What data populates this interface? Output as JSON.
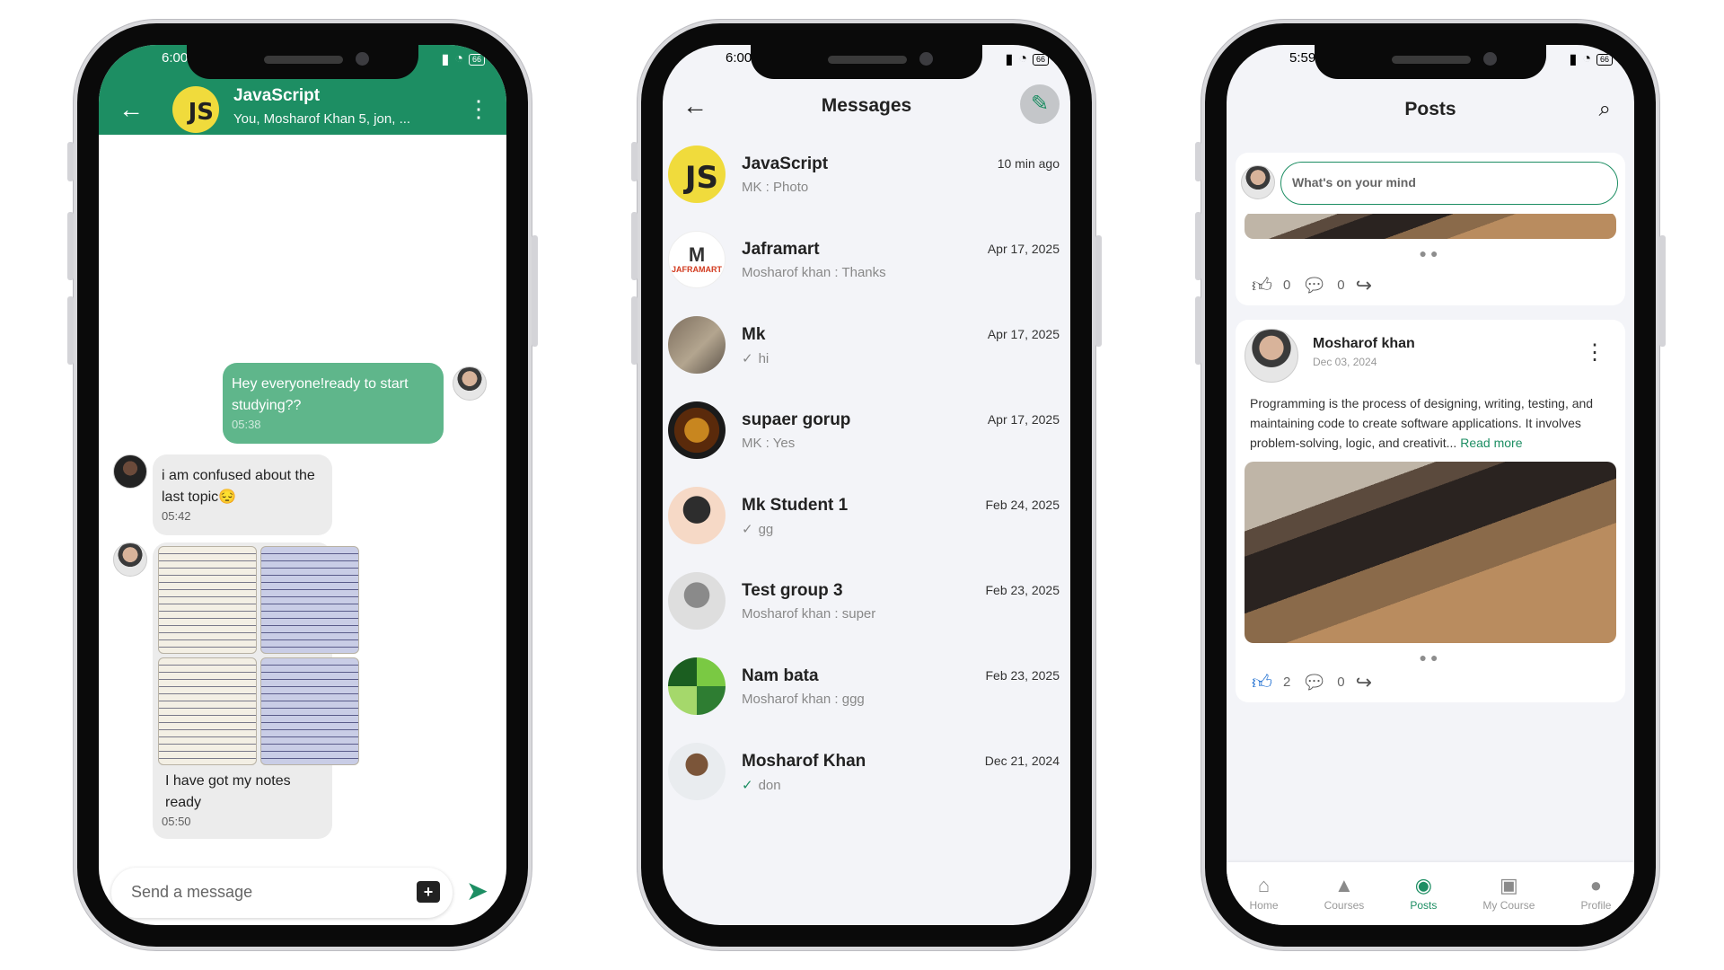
{
  "colors": {
    "primary_green": "#1d8e63",
    "bubble_out": "#5fb68b",
    "js_yellow": "#f0db3c",
    "like_blue": "#1f6fd1"
  },
  "chat_screen": {
    "status_time": "6:00",
    "battery": "66",
    "header": {
      "title": "JavaScript",
      "subtitle": "You, Mosharof Khan 5, jon, ...",
      "avatar_text": "JS"
    },
    "messages": [
      {
        "direction": "out",
        "text": "Hey everyone!ready to start studying??",
        "time": "05:38"
      },
      {
        "direction": "in",
        "text": "i am confused about the last topic😔",
        "time": "05:42"
      },
      {
        "direction": "in",
        "type": "image",
        "caption": "I have got my notes ready",
        "time": "05:50"
      }
    ],
    "composer": {
      "placeholder": "Send a message"
    }
  },
  "messages_screen": {
    "status_time": "6:00",
    "battery": "66",
    "title": "Messages",
    "conversations": [
      {
        "name": "JavaScript",
        "avatar_text": "JS",
        "last": "MK :  Photo",
        "date": "10 min ago"
      },
      {
        "name": "Jaframart",
        "avatar_text": "JAFRAMART",
        "last": "Mosharof khan :  Thanks",
        "date": "Apr 17, 2025"
      },
      {
        "name": "Mk",
        "last": "hi",
        "date": "Apr 17, 2025",
        "tick": "single"
      },
      {
        "name": "supaer gorup",
        "last": "MK :  Yes",
        "date": "Apr 17, 2025"
      },
      {
        "name": "Mk Student 1",
        "last": "gg",
        "date": "Feb 24, 2025",
        "tick": "single"
      },
      {
        "name": "Test group 3",
        "last": "Mosharof khan :  super",
        "date": "Feb 23, 2025"
      },
      {
        "name": "Nam bata",
        "last": "Mosharof khan :  ggg",
        "date": "Feb 23, 2025"
      },
      {
        "name": "Mosharof Khan",
        "last": "don",
        "date": "Dec 21, 2024",
        "tick": "double"
      }
    ]
  },
  "posts_screen": {
    "status_time": "5:59",
    "battery": "66",
    "title": "Posts",
    "compose_placeholder": "What's on your mind",
    "posts": [
      {
        "likes": "0",
        "comments": "0",
        "liked": false
      },
      {
        "author": "Mosharof khan",
        "date": "Dec 03, 2024",
        "text": "Programming is the process of designing, writing, testing, and maintaining code to create software applications. It involves problem-solving, logic, and creativit...",
        "read_more": "Read more",
        "likes": "2",
        "comments": "0",
        "liked": true
      }
    ],
    "nav": [
      {
        "label": "Home",
        "icon": "home-icon",
        "active": false
      },
      {
        "label": "Courses",
        "icon": "courses-icon",
        "active": false
      },
      {
        "label": "Posts",
        "icon": "posts-icon",
        "active": true
      },
      {
        "label": "My Course",
        "icon": "bag-icon",
        "active": false
      },
      {
        "label": "Profile",
        "icon": "person-icon",
        "active": false
      }
    ]
  }
}
